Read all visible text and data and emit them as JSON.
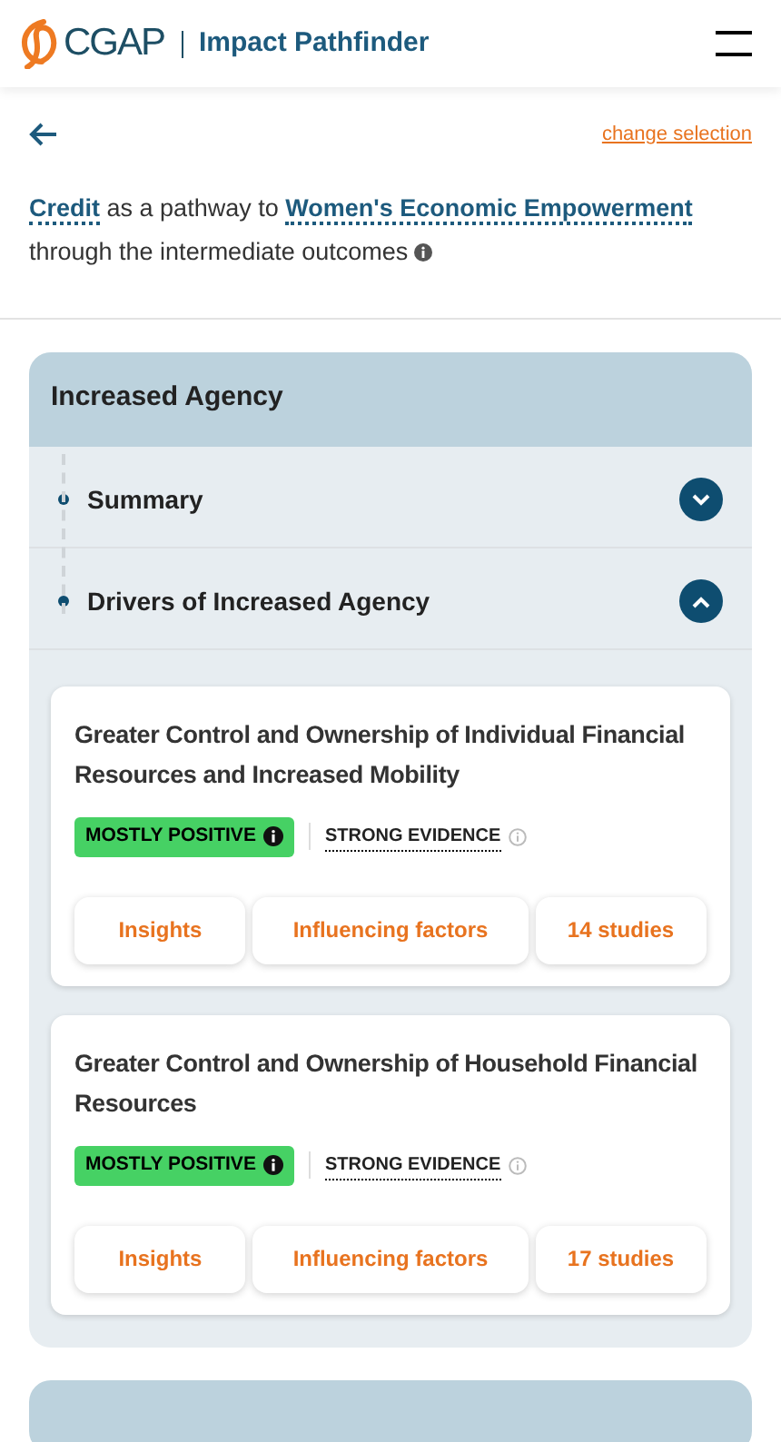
{
  "header": {
    "brand": "CGAP",
    "product": "Impact Pathfinder"
  },
  "nav": {
    "change_link": "change selection"
  },
  "intro": [
    {
      "kind": "link",
      "text": "Credit"
    },
    {
      "kind": "text",
      "text": "as a pathway to"
    },
    {
      "kind": "link",
      "text": "Women's Economic Empowerment"
    },
    {
      "kind": "text",
      "text": "through the intermediate outcomes"
    },
    {
      "kind": "info"
    }
  ],
  "sections": [
    {
      "title": "Increased Agency",
      "expanded": true,
      "subsections": [
        {
          "title": "Summary",
          "expanded": false
        },
        {
          "title": "Drivers of Increased Agency",
          "expanded": true,
          "outcomes": [
            {
              "title": "Greater Control and Ownership of Individual Financial Resources and Increased Mobility",
              "direction": "MOSTLY POSITIVE",
              "color": "#46d164",
              "evidence": "STRONG EVIDENCE",
              "actions": [
                "Insights",
                "Influencing factors",
                "14 studies"
              ]
            },
            {
              "title": "Greater Control and Ownership of Household Financial Resources",
              "direction": "MOSTLY POSITIVE",
              "color": "#46d164",
              "evidence": "STRONG EVIDENCE",
              "actions": [
                "Insights",
                "Influencing factors",
                "17 studies"
              ]
            }
          ]
        }
      ]
    },
    {
      "expanded": false
    }
  ]
}
